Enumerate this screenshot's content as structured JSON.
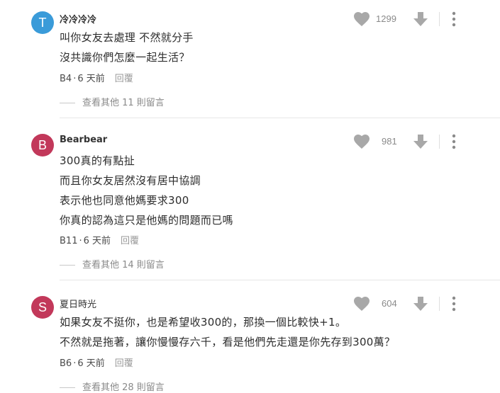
{
  "comments": [
    {
      "avatar_letter": "T",
      "avatar_color": "#3a9bd9",
      "author": "冷冷冷冷",
      "lines": [
        "叫你女友去處理 不然就分手",
        "沒共識你們怎麼一起生活？"
      ],
      "floor": "B4",
      "time": "6 天前",
      "reply_label": "回覆",
      "likes": "1299",
      "more_replies": "查看其他 11 則留言"
    },
    {
      "avatar_letter": "B",
      "avatar_color": "#c2385a",
      "author": "Bearbear",
      "lines": [
        "300真的有點扯",
        "而且你女友居然沒有居中協調",
        "表示他也同意他媽要求300",
        "你真的認為這只是他媽的問題而已嗎"
      ],
      "floor": "B11",
      "time": "6 天前",
      "reply_label": "回覆",
      "likes": "981",
      "more_replies": "查看其他 14 則留言"
    },
    {
      "avatar_letter": "S",
      "avatar_color": "#c2385a",
      "author": "夏日時光",
      "lines": [
        "如果女友不挺你，也是希望收300的，那換一個比較快+1。",
        "不然就是拖著，讓你慢慢存六千，看是他們先走還是你先存到300萬？"
      ],
      "floor": "B6",
      "time": "6 天前",
      "reply_label": "回覆",
      "likes": "604",
      "more_replies": "查看其他 28 則留言"
    }
  ],
  "icons": {
    "like": "heart-icon",
    "dislike": "arrow-down-icon",
    "menu": "more-vertical-icon"
  },
  "colors": {
    "icon_gray": "#9e9e9e"
  }
}
